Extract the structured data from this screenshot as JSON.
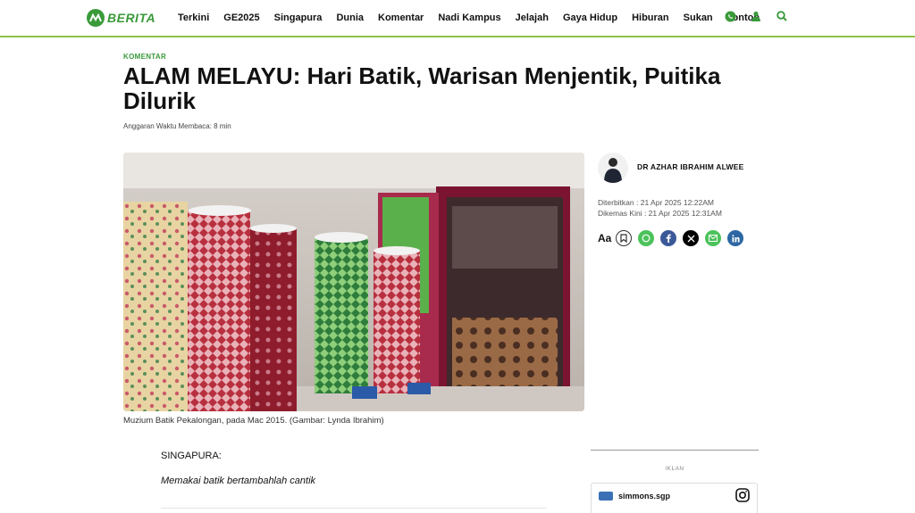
{
  "brand": {
    "name": "BERITA",
    "color": "#3a9a3a",
    "accent_line": "#8bc34a"
  },
  "nav": {
    "items": [
      "Terkini",
      "GE2025",
      "Singapura",
      "Dunia",
      "Komentar",
      "Nadi Kampus",
      "Jelajah",
      "Gaya Hidup",
      "Hiburan",
      "Sukan",
      "Tonton"
    ],
    "icons": [
      "whatsapp-icon",
      "user-icon",
      "search-icon"
    ]
  },
  "article": {
    "category": "KOMENTAR",
    "title": "ALAM MELAYU: Hari Batik, Warisan Menjentik, Puitika Dilurik",
    "reading_time": "Anggaran Waktu Membaca: 8 min",
    "image_caption": "Muzium Batik Pekalongan, pada Mac 2015. (Gambar: Lynda Ibrahim)",
    "author": "DR AZHAR IBRAHIM ALWEE",
    "published": "Diterbitkan : 21 Apr 2025 12:22AM",
    "updated": "Dikemas Kini : 21 Apr 2025 12:31AM",
    "font_size_label": "Aa",
    "share": [
      "bookmark-icon",
      "whatsapp-icon",
      "facebook-icon",
      "x-icon",
      "email-icon",
      "linkedin-icon"
    ],
    "dateline": "SINGAPURA:",
    "lead": "Memakai batik bertambahlah cantik"
  },
  "ad": {
    "label": "IKLAN",
    "brand": "simmons.sgp"
  }
}
